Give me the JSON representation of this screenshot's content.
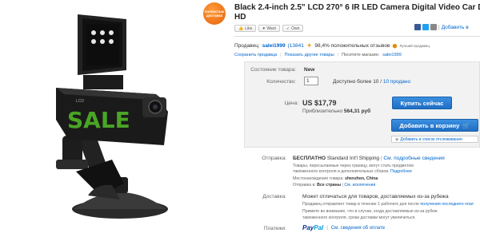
{
  "badge": {
    "text": "полностью доставка"
  },
  "title": {
    "line1": "Black 2.4-inch 2.5\" LCD 270° 6 IR LED Camera Digital Video Car D",
    "line2": "HD"
  },
  "social": {
    "like": "Like",
    "want": "Want",
    "own": "Own",
    "add_to_list": "Добавить в"
  },
  "seller": {
    "label": "Продавец:",
    "name": "salei1999",
    "feedback": "(13841",
    "rating": "98,4% положительных отзывов",
    "top_seller": "Лучший продавец",
    "links": [
      "Сохранить продавца",
      "Показать другие товары",
      "Посетите магазин:",
      "salei1999"
    ]
  },
  "item": {
    "condition_label": "Состояние товара:",
    "condition_value": "New",
    "quantity_label": "Количество:",
    "quantity_value": "1",
    "available": "Доступно более 10 /",
    "sold": "10 продано",
    "price_label": "Цена:",
    "price": "US $17,79",
    "approx_label": "Приблизительно",
    "approx_value": "564,31 руб",
    "buy_now": "Купить сейчас",
    "add_to_cart": "Добавить в корзину",
    "watch": "Добавить в список отслеживания"
  },
  "shipping": {
    "label": "Отправка:",
    "free": "БЕСПЛАТНО",
    "method": "Standard Int'l Shipping",
    "details_link": "См. подробные сведения",
    "note1": "Товары, пересылаемые через границу, могут стать предметом",
    "note2": "таможенного контроля и дополнительных сборов.",
    "more": "Подробнее",
    "location_label": "Местонахождение товара:",
    "location": "shenzhen, China",
    "ship_to_label": "Отправка в:",
    "ship_to": "Все страны",
    "exclusions": "См. исключения"
  },
  "delivery": {
    "label": "Доставка:",
    "text": "Может отличаться для товаров, доставляемых из-за рубежа",
    "note1": "Продавец отправляет товар в течение 1 рабочего дня после",
    "note1_link": "получения последнего плат",
    "note2": "Примите во внимание, что в случае, когда доставляемые из-за рубеж",
    "note3": "таможенного контроля, сроки доставки могут увеличиться."
  },
  "payments": {
    "label": "Платежи:",
    "paypal": "PayPal",
    "link": "См. сведения об оплате"
  },
  "colors": {
    "link": "#0066cc",
    "button": "#2a7ed6",
    "box_bg": "#f2f2f2",
    "watermark": "#5ad22a"
  }
}
